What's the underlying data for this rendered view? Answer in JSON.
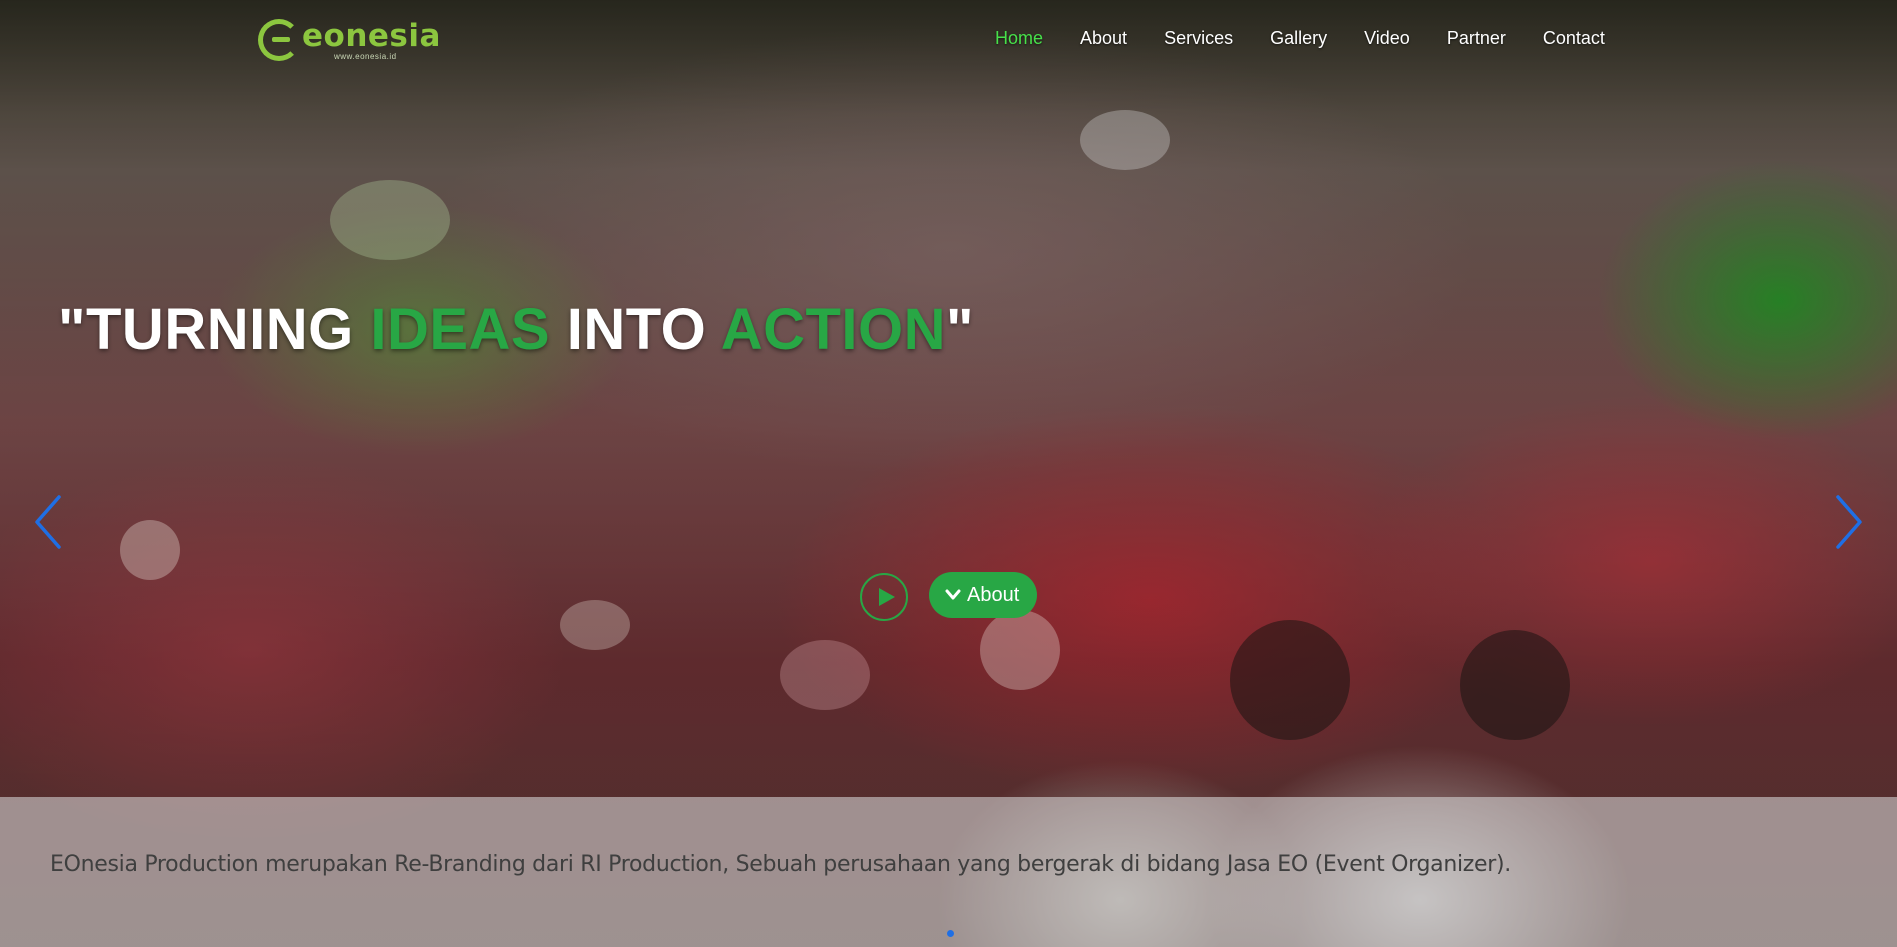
{
  "logo": {
    "word": "eonesia",
    "url": "www.eonesia.id"
  },
  "nav": {
    "items": [
      {
        "label": "Home",
        "active": true
      },
      {
        "label": "About",
        "active": false
      },
      {
        "label": "Services",
        "active": false
      },
      {
        "label": "Gallery",
        "active": false
      },
      {
        "label": "Video",
        "active": false
      },
      {
        "label": "Partner",
        "active": false
      },
      {
        "label": "Contact",
        "active": false
      }
    ]
  },
  "hero": {
    "headline": {
      "open_quote": "\"",
      "word1": "TURNING",
      "word2": "IDEAS",
      "word3": "INTO",
      "word4": "ACTION",
      "close_quote": "\""
    },
    "about_button": "About",
    "play_icon": "play-circle-icon",
    "prev_icon": "chevron-left-icon",
    "next_icon": "chevron-right-icon",
    "caption": "EOnesia Production merupakan Re-Branding dari RI Production, Sebuah perusahaan yang bergerak di bidang Jasa EO (Event Organizer)."
  },
  "colors": {
    "accent_green": "#28a745",
    "nav_active": "#47e04a",
    "logo_green": "#8cc63f",
    "arrow_blue": "#1f6fe5"
  }
}
